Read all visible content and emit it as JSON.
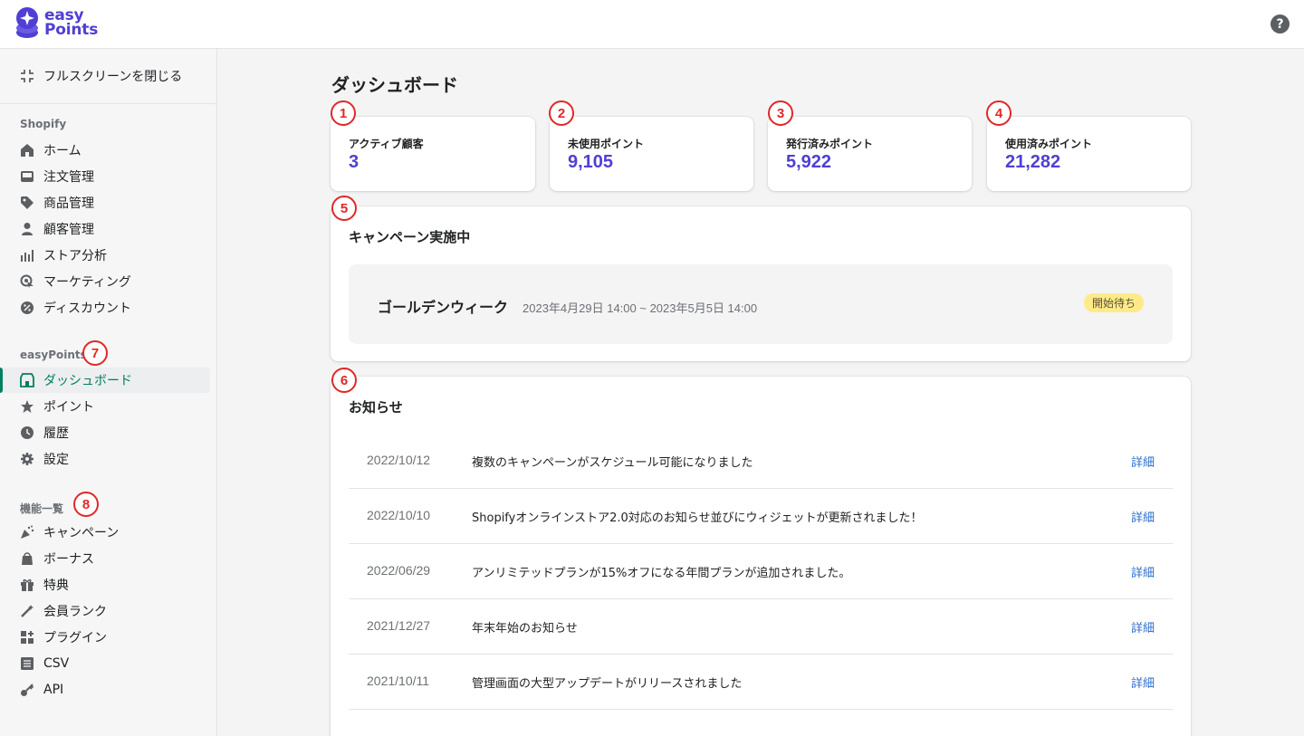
{
  "app": {
    "logo_line1": "easy",
    "logo_line2": "Points",
    "help_label": "?"
  },
  "sidebar": {
    "exit_label": "フルスクリーンを閉じる",
    "sections": [
      {
        "title": "Shopify",
        "items": [
          "ホーム",
          "注文管理",
          "商品管理",
          "顧客管理",
          "ストア分析",
          "マーケティング",
          "ディスカウント"
        ]
      },
      {
        "title": "easyPoints",
        "items": [
          "ダッシュボード",
          "ポイント",
          "履歴",
          "設定"
        ]
      },
      {
        "title": "機能一覧",
        "items": [
          "キャンペーン",
          "ボーナス",
          "特典",
          "会員ランク",
          "プラグイン",
          "CSV",
          "API"
        ]
      }
    ],
    "active_item": "ダッシュボード"
  },
  "annotations": [
    "1",
    "2",
    "3",
    "4",
    "5",
    "6",
    "7",
    "8"
  ],
  "main": {
    "title": "ダッシュボード",
    "stats": [
      {
        "label": "アクティブ顧客",
        "value": "3"
      },
      {
        "label": "未使用ポイント",
        "value": "9,105"
      },
      {
        "label": "発行済みポイント",
        "value": "5,922"
      },
      {
        "label": "使用済みポイント",
        "value": "21,282"
      }
    ],
    "campaign": {
      "section_title": "キャンペーン実施中",
      "name": "ゴールデンウィーク",
      "period": "2023年4月29日 14:00 ~ 2023年5月5日 14:00",
      "status": "開始待ち"
    },
    "news": {
      "section_title": "お知らせ",
      "link_label": "詳細",
      "items": [
        {
          "date": "2022/10/12",
          "text": "複数のキャンペーンがスケジュール可能になりました"
        },
        {
          "date": "2022/10/10",
          "text": "Shopifyオンラインストア2.0対応のお知らせ並びにウィジェットが更新されました！"
        },
        {
          "date": "2022/06/29",
          "text": "アンリミテッドプランが15%オフになる年間プランが追加されました。"
        },
        {
          "date": "2021/12/27",
          "text": "年末年始のお知らせ"
        },
        {
          "date": "2021/10/11",
          "text": "管理画面の大型アップデートがリリースされました"
        }
      ]
    }
  },
  "colors": {
    "accent": "#4f3fd4",
    "active_nav": "#007f5f",
    "link": "#2c6ecb",
    "annotation": "#e02828",
    "status_badge": "#ffea8a"
  }
}
